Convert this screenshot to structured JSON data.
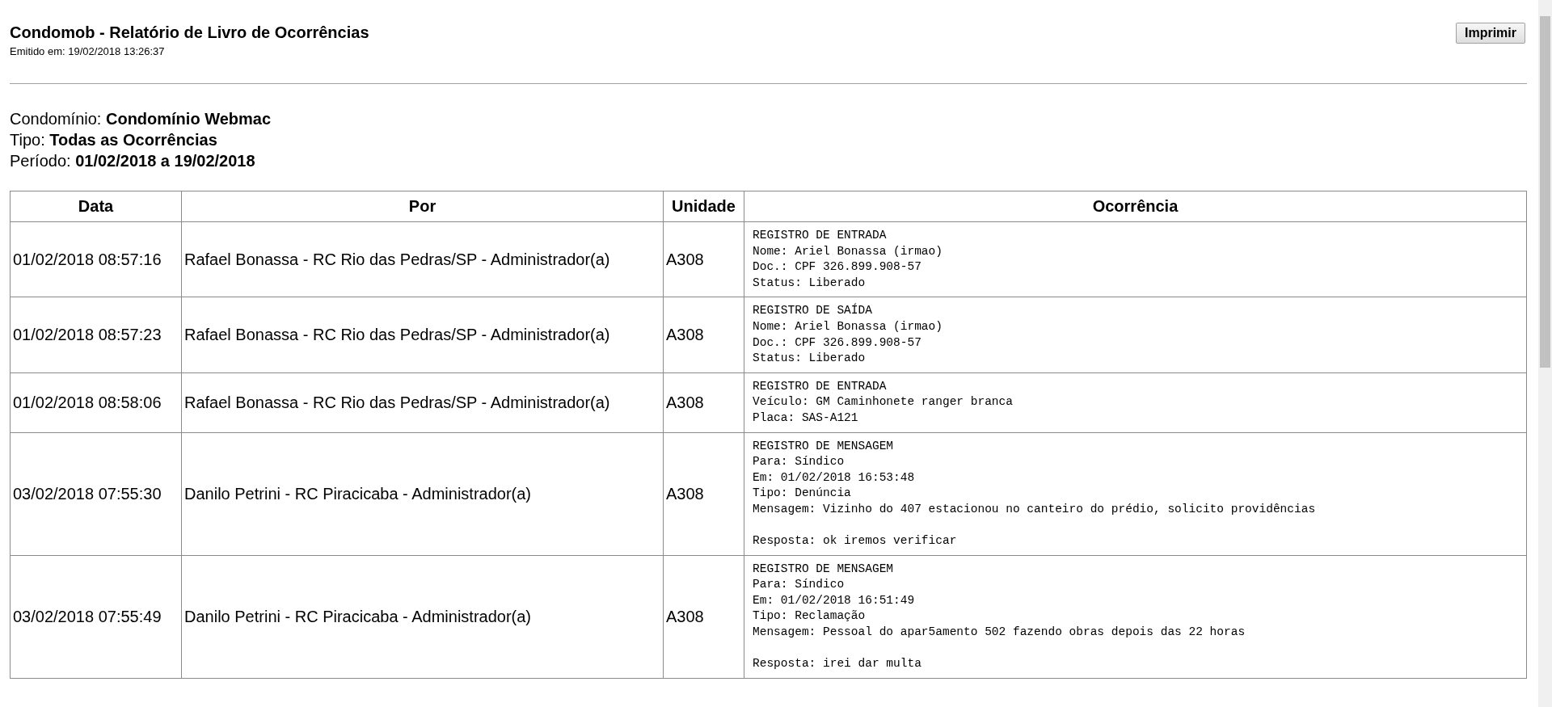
{
  "header": {
    "title": "Condomob - Relatório de Livro de Ocorrências",
    "issued": "Emitido em: 19/02/2018 13:26:37",
    "print_button": "Imprimir"
  },
  "filters": [
    {
      "label": "Condomínio:",
      "value": "Condomínio Webmac"
    },
    {
      "label": "Tipo:",
      "value": "Todas as Ocorrências"
    },
    {
      "label": "Período:",
      "value": "01/02/2018 a 19/02/2018"
    }
  ],
  "table": {
    "columns": [
      "Data",
      "Por",
      "Unidade",
      "Ocorrência"
    ],
    "rows": [
      {
        "date": "01/02/2018 08:57:16",
        "by": "Rafael Bonassa - RC Rio das Pedras/SP - Administrador(a)",
        "unit": "A308",
        "occurrence": "REGISTRO DE ENTRADA\nNome: Ariel Bonassa (irmao)\nDoc.: CPF 326.899.908-57\nStatus: Liberado"
      },
      {
        "date": "01/02/2018 08:57:23",
        "by": "Rafael Bonassa - RC Rio das Pedras/SP - Administrador(a)",
        "unit": "A308",
        "occurrence": "REGISTRO DE SAÍDA\nNome: Ariel Bonassa (irmao)\nDoc.: CPF 326.899.908-57\nStatus: Liberado"
      },
      {
        "date": "01/02/2018 08:58:06",
        "by": "Rafael Bonassa - RC Rio das Pedras/SP - Administrador(a)",
        "unit": "A308",
        "occurrence": "REGISTRO DE ENTRADA\nVeículo: GM Caminhonete ranger branca\nPlaca: SAS-A121"
      },
      {
        "date": "03/02/2018 07:55:30",
        "by": "Danilo Petrini - RC Piracicaba - Administrador(a)",
        "unit": "A308",
        "occurrence": "REGISTRO DE MENSAGEM\nPara: Síndico\nEm: 01/02/2018 16:53:48\nTipo: Denúncia\nMensagem: Vizinho do 407 estacionou no canteiro do prédio, solicito providências\n\nResposta: ok iremos verificar"
      },
      {
        "date": "03/02/2018 07:55:49",
        "by": "Danilo Petrini - RC Piracicaba - Administrador(a)",
        "unit": "A308",
        "occurrence": "REGISTRO DE MENSAGEM\nPara: Síndico\nEm: 01/02/2018 16:51:49\nTipo: Reclamação\nMensagem: Pessoal do apar5amento 502 fazendo obras depois das 22 horas\n\nResposta: irei dar multa"
      }
    ]
  }
}
